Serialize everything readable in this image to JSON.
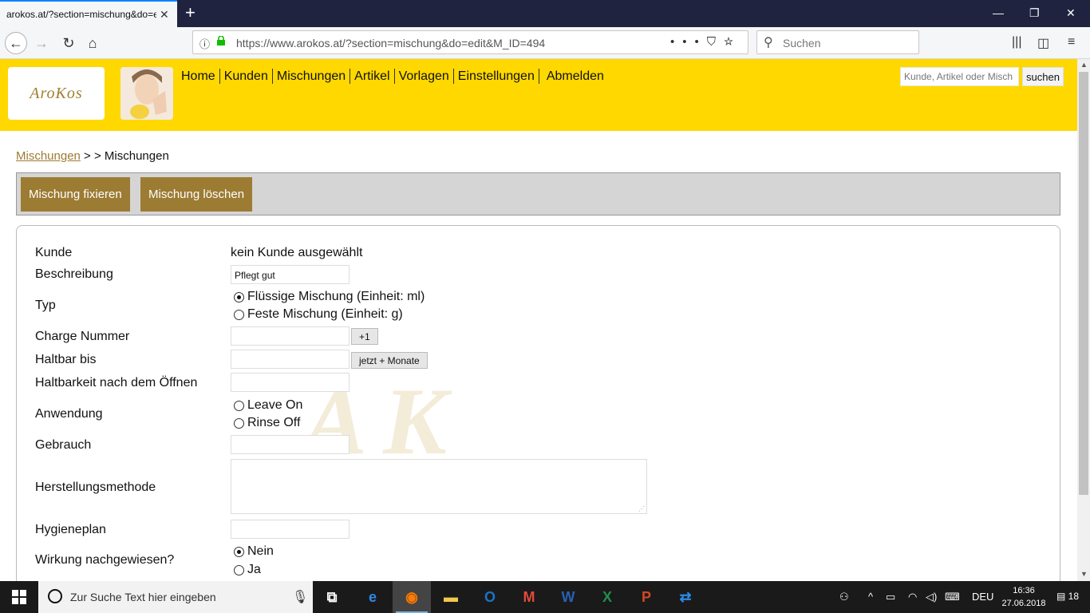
{
  "browser": {
    "tab_title": "arokos.at/?section=mischung&do=e",
    "url": "https://www.arokos.at/?section=mischung&do=edit&M_ID=494",
    "search_placeholder": "Suchen"
  },
  "site": {
    "logo_text": "AroKos",
    "nav": [
      "Home",
      "Kunden",
      "Mischungen",
      "Artikel",
      "Vorlagen",
      "Einstellungen",
      "Abmelden"
    ],
    "search_placeholder": "Kunde, Artikel oder Misch",
    "search_button": "suchen"
  },
  "breadcrumb": {
    "link": "Mischungen",
    "sep": " > > ",
    "current": "Mischungen"
  },
  "actions": {
    "fix": "Mischung fixieren",
    "delete": "Mischung löschen"
  },
  "form": {
    "kunde_label": "Kunde",
    "kunde_value": "kein Kunde ausgewählt",
    "beschreibung_label": "Beschreibung",
    "beschreibung_value": "Pflegt gut",
    "typ_label": "Typ",
    "typ_options": [
      {
        "label": "Flüssige Mischung (Einheit: ml)",
        "selected": true
      },
      {
        "label": "Feste Mischung (Einheit: g)",
        "selected": false
      }
    ],
    "charge_label": "Charge Nummer",
    "charge_button": "+1",
    "haltbar_label": "Haltbar bis",
    "haltbar_button": "jetzt + Monate",
    "oeffnen_label": "Haltbarkeit nach dem Öffnen",
    "anwendung_label": "Anwendung",
    "anwendung_options": [
      {
        "label": "Leave On",
        "selected": false
      },
      {
        "label": "Rinse Off",
        "selected": false
      }
    ],
    "gebrauch_label": "Gebrauch",
    "herstellung_label": "Herstellungsmethode",
    "hygiene_label": "Hygieneplan",
    "wirkung_label": "Wirkung nachgewiesen?",
    "wirkung_options": [
      {
        "label": "Nein",
        "selected": true
      },
      {
        "label": "Ja",
        "selected": false
      }
    ]
  },
  "taskbar": {
    "search_placeholder": "Zur Suche Text hier eingeben",
    "language": "DEU",
    "time": "16:36",
    "date": "27.06.2018",
    "notifications": "18"
  }
}
